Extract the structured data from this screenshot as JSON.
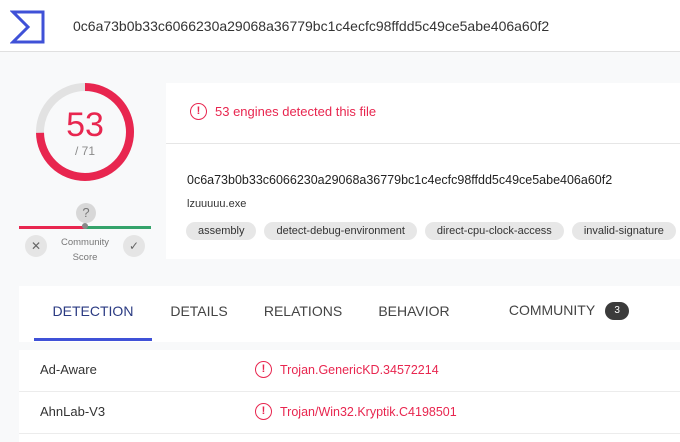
{
  "header": {
    "logo_icon": "virustotal-sigma-logo",
    "search_value": "0c6a73b0b33c6066230a29068a36779bc1c4ecfc98ffdd5c49ce5abe406a60f2"
  },
  "score": {
    "detected": "53",
    "total": "/ 71",
    "detection_fraction": 0.746,
    "community": {
      "unknown_symbol": "?",
      "down_symbol": "✕",
      "up_symbol": "✓",
      "label_line1": "Community",
      "label_line2": "Score"
    }
  },
  "summary": {
    "alert_symbol": "!",
    "alert_text": "53 engines detected this file",
    "hash": "0c6a73b0b33c6066230a29068a36779bc1c4ecfc98ffdd5c49ce5abe406a60f2",
    "file_name": "lzuuuuu.exe",
    "tags": [
      "assembly",
      "detect-debug-environment",
      "direct-cpu-clock-access",
      "invalid-signature"
    ]
  },
  "tabs": [
    {
      "label": "DETECTION"
    },
    {
      "label": "DETAILS"
    },
    {
      "label": "RELATIONS"
    },
    {
      "label": "BEHAVIOR"
    },
    {
      "label": "COMMUNITY",
      "badge": "3"
    }
  ],
  "detections": [
    {
      "engine": "Ad-Aware",
      "symbol": "!",
      "result": "Trojan.GenericKD.34572214"
    },
    {
      "engine": "AhnLab-V3",
      "symbol": "!",
      "result": "Trojan/Win32.Kryptik.C4198501"
    }
  ],
  "colors": {
    "accent": "#e8264f",
    "brand_blue": "#3f51d7",
    "good": "#35a36b"
  }
}
